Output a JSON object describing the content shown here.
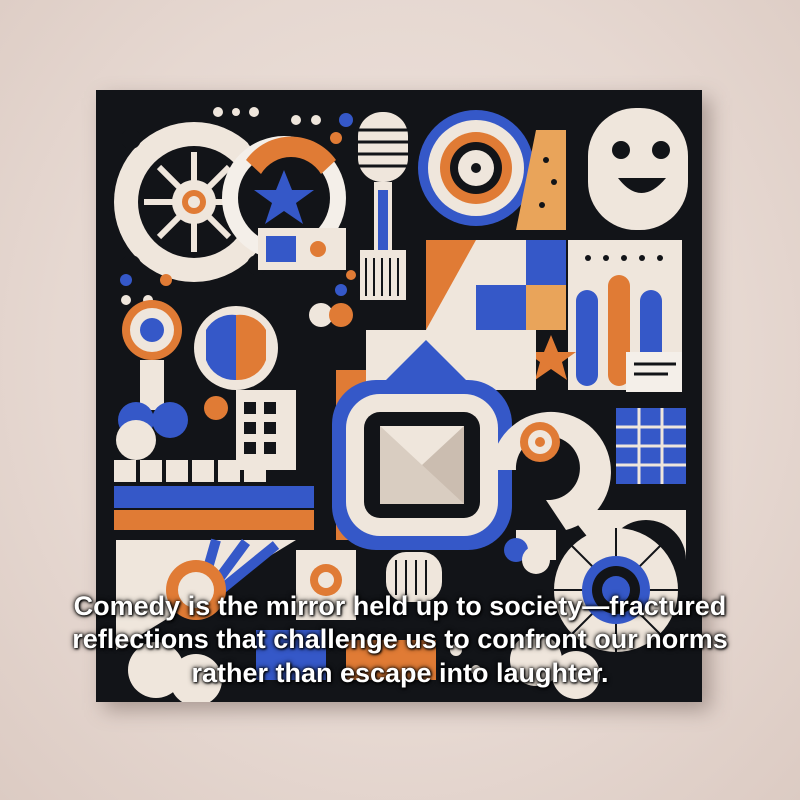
{
  "image": {
    "subject": "abstract-comedy-artwork-canvas",
    "colors": {
      "background_wall": "#e9ddd7",
      "canvas_base": "#121418",
      "cream": "#efe6dc",
      "orange": "#e07b35",
      "blue": "#3558c8",
      "white": "#f4efe9"
    },
    "icons": [
      "gear-icon",
      "star-icon",
      "microphone-icon",
      "vinyl-record-icon",
      "smiley-face-icon",
      "question-mark-icon",
      "chevron-tile-icon"
    ]
  },
  "caption": {
    "text": "Comedy is the mirror held up to society—fractured reflections that challenge us to confront our norms rather than escape into laughter."
  }
}
